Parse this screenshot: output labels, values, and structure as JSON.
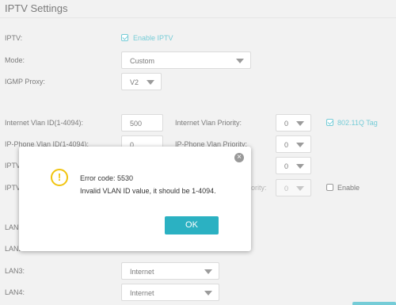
{
  "header": {
    "title": "IPTV Settings"
  },
  "form": {
    "iptv_label": "IPTV:",
    "enable_iptv_label": "Enable IPTV",
    "mode_label": "Mode:",
    "mode_value": "Custom",
    "igmp_label": "IGMP Proxy:",
    "igmp_value": "V2",
    "internet_vlan_id_label": "Internet Vlan ID(1-4094):",
    "internet_vlan_id_value": "500",
    "internet_vlan_priority_label": "Internet Vlan Priority:",
    "internet_vlan_priority_value": "0",
    "tag_label": "802.11Q Tag",
    "phone_vlan_id_label": "IP-Phone Vlan ID(1-4094):",
    "phone_vlan_id_value": "0",
    "phone_vlan_priority_label": "IP-Phone Vlan Priority:",
    "phone_vlan_priority_value": "0",
    "row3_label_partial": "IPTV",
    "row3_priority_value": "0",
    "row4_label_partial": "IPTV",
    "row4_priority_label_partial": "ority:",
    "row4_priority_value": "0",
    "row4_enable_label": "Enable",
    "lan1_label": "LAN1",
    "lan2_label": "LAN2",
    "lan3_label": "LAN3:",
    "lan3_value": "Internet",
    "lan4_label": "LAN4:",
    "lan4_value": "Internet"
  },
  "dialog": {
    "title": "Error code: 5530",
    "message": "Invalid VLAN ID value, it should be 1-4094.",
    "ok_label": "OK",
    "close_glyph": "×",
    "warn_glyph": "!"
  },
  "colors": {
    "accent": "#2bb1c2",
    "warning": "#f1c40f"
  }
}
